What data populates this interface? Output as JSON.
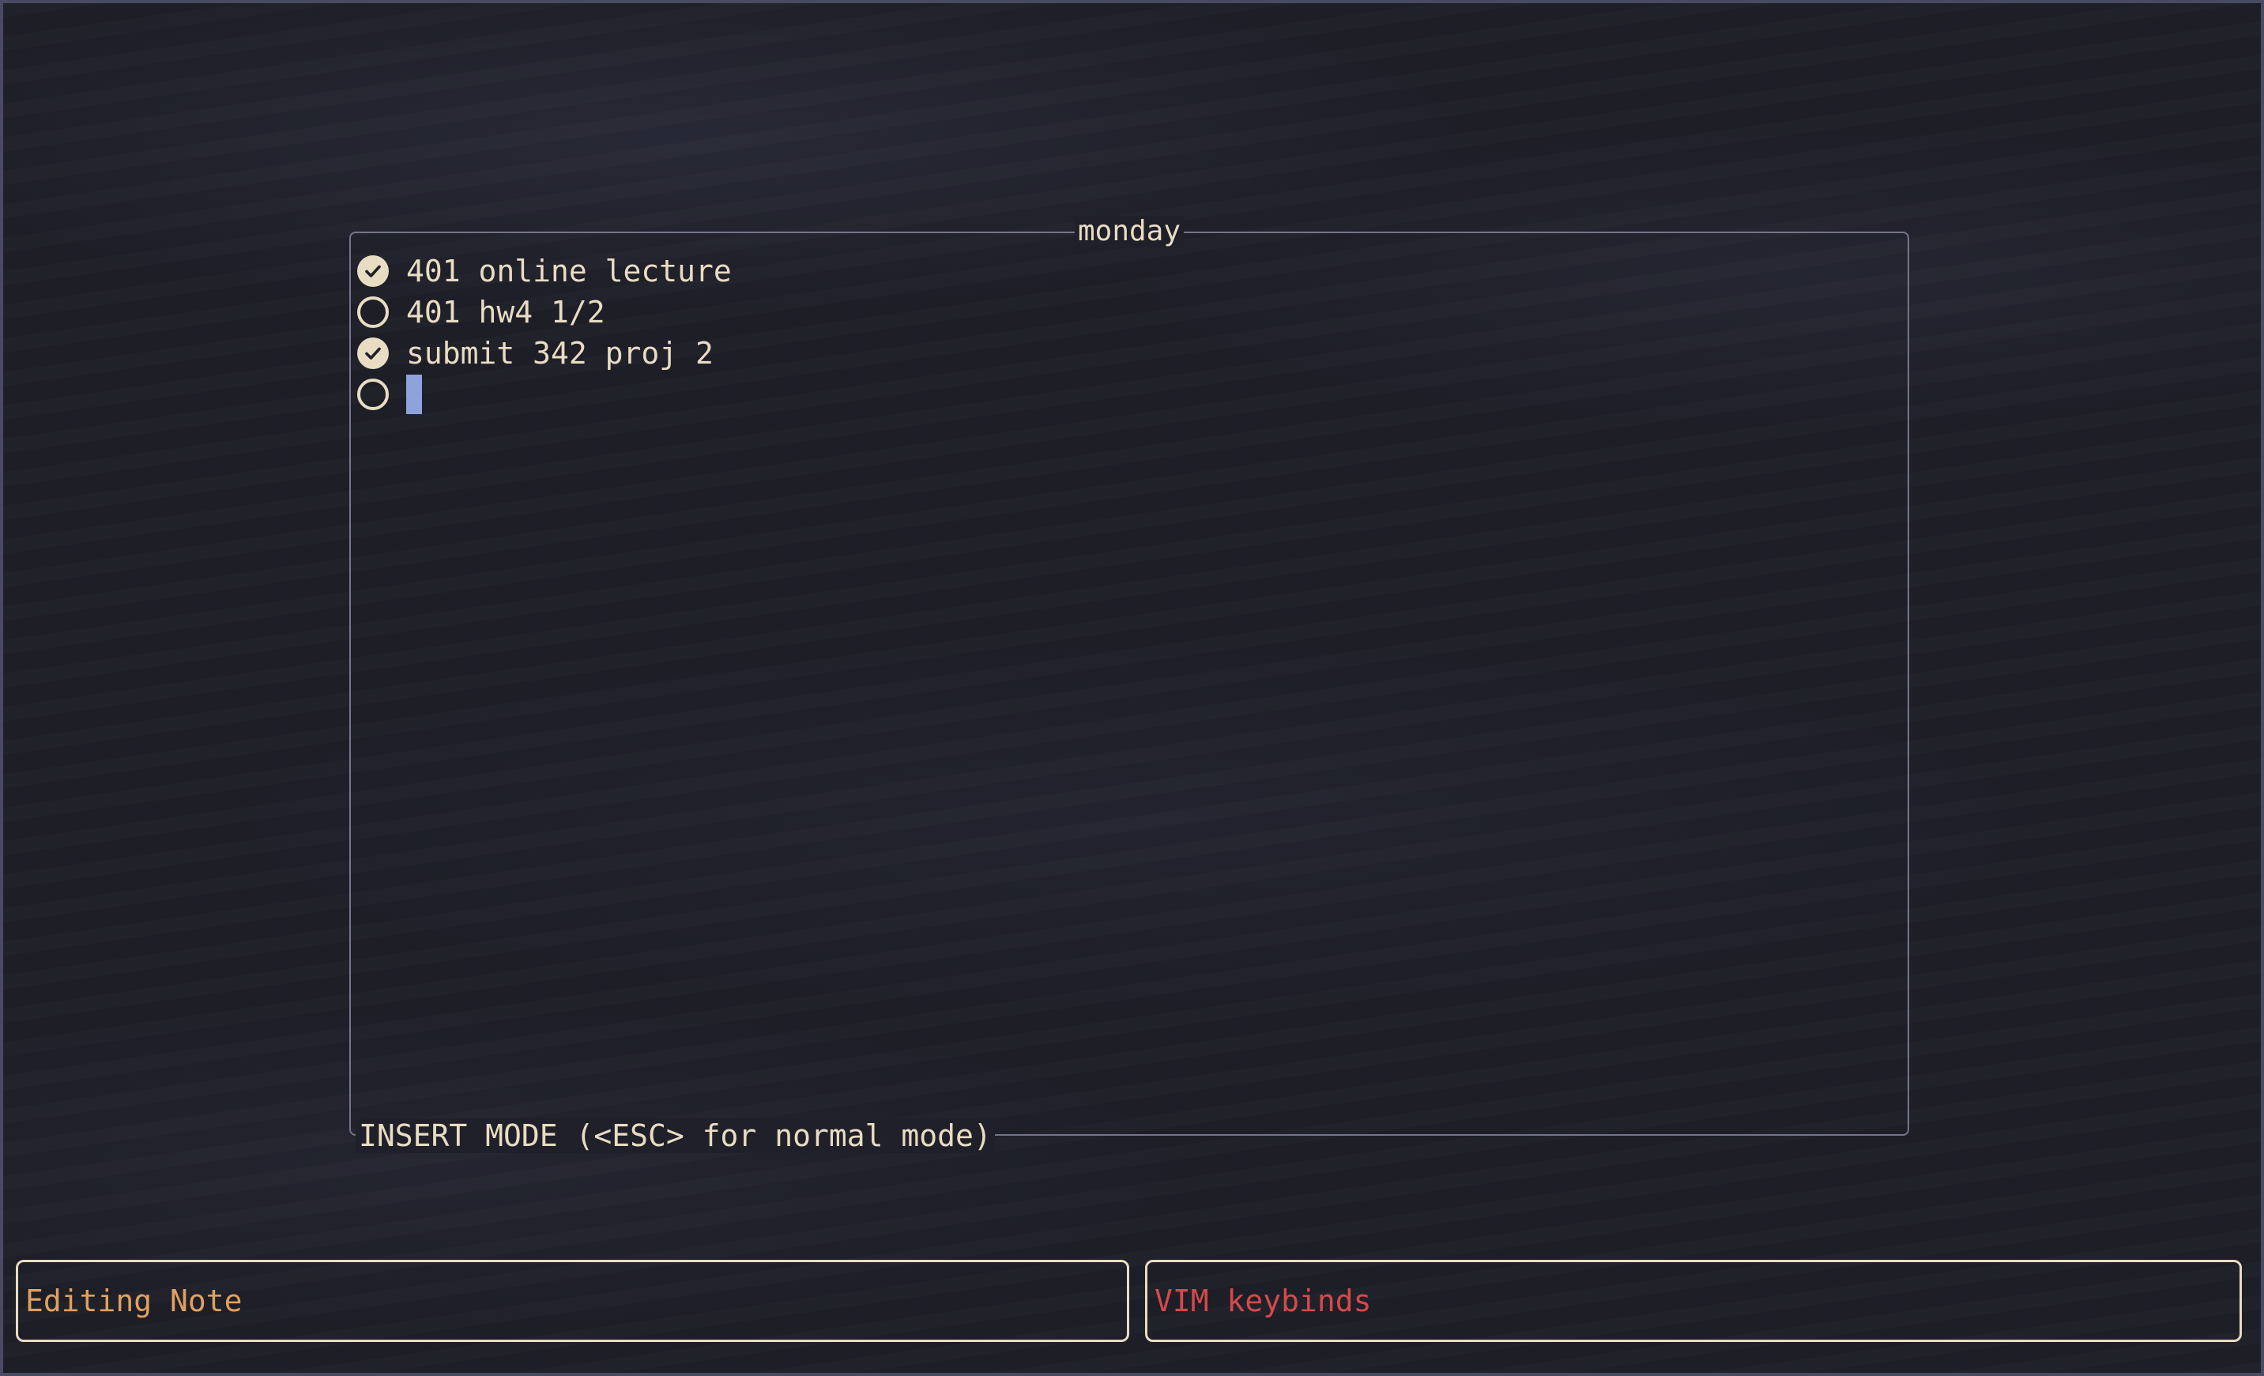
{
  "note": {
    "title": "monday",
    "mode_label": "INSERT MODE (<ESC> for normal mode)",
    "items": [
      {
        "text": "401 online lecture",
        "done": true
      },
      {
        "text": "401 hw4 1/2",
        "done": false
      },
      {
        "text": "submit 342 proj 2",
        "done": true
      },
      {
        "text": "",
        "done": false
      }
    ]
  },
  "status": {
    "left_label": "Editing Note",
    "right_label": "VIM keybinds"
  },
  "icons": {
    "done": "check-circle-icon",
    "open": "empty-circle-icon"
  },
  "colors": {
    "text": "#e8dcc2",
    "left_status": "#e0a060",
    "right_status": "#d44a4a",
    "cursor": "#8ea2dc"
  }
}
